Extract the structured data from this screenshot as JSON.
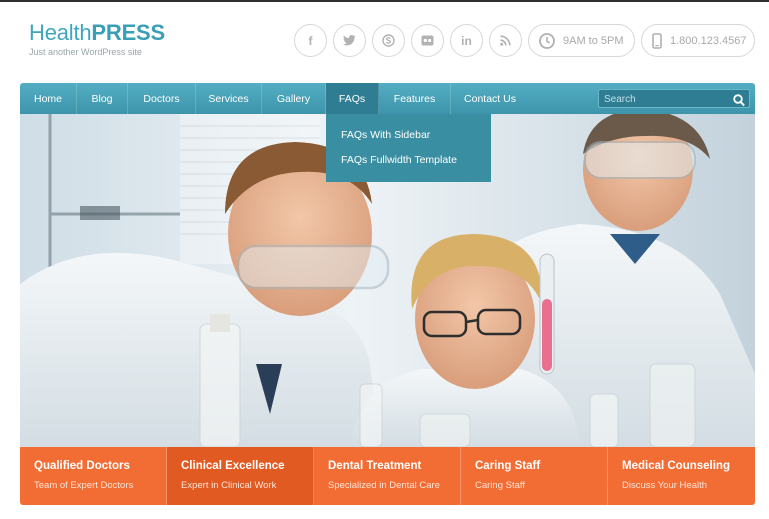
{
  "logo": {
    "name_light": "Health",
    "name_bold": "PRESS",
    "tagline": "Just another WordPress site"
  },
  "header": {
    "social_icons": [
      "facebook-icon",
      "twitter-icon",
      "skype-icon",
      "flickr-icon",
      "linkedin-icon",
      "rss-icon"
    ],
    "social_glyphs": [
      "f",
      "t",
      "S",
      "••",
      "in",
      ")))"
    ],
    "hours": "9AM to 5PM",
    "phone": "1.800.123.4567"
  },
  "nav": {
    "items": [
      "Home",
      "Blog",
      "Doctors",
      "Services",
      "Gallery",
      "FAQs",
      "Features",
      "Contact Us"
    ],
    "active": "FAQs",
    "search_placeholder": "Search"
  },
  "dropdown": {
    "items": [
      "FAQs With Sidebar",
      "FAQs Fullwidth Template"
    ]
  },
  "features": [
    {
      "title": "Qualified Doctors",
      "subtitle": "Team of Expert Doctors"
    },
    {
      "title": "Clinical Excellence",
      "subtitle": "Expert in Clinical Work"
    },
    {
      "title": "Dental Treatment",
      "subtitle": "Specialized in Dental Care"
    },
    {
      "title": "Caring Staff",
      "subtitle": "Caring Staff"
    },
    {
      "title": "Medical Counseling",
      "subtitle": "Discuss Your Health"
    }
  ],
  "colors": {
    "brand": "#3fa6bd",
    "nav": "#4aa3b9",
    "nav_active": "#2f7d92",
    "features": "#f26d34",
    "features_active": "#e05a22"
  }
}
